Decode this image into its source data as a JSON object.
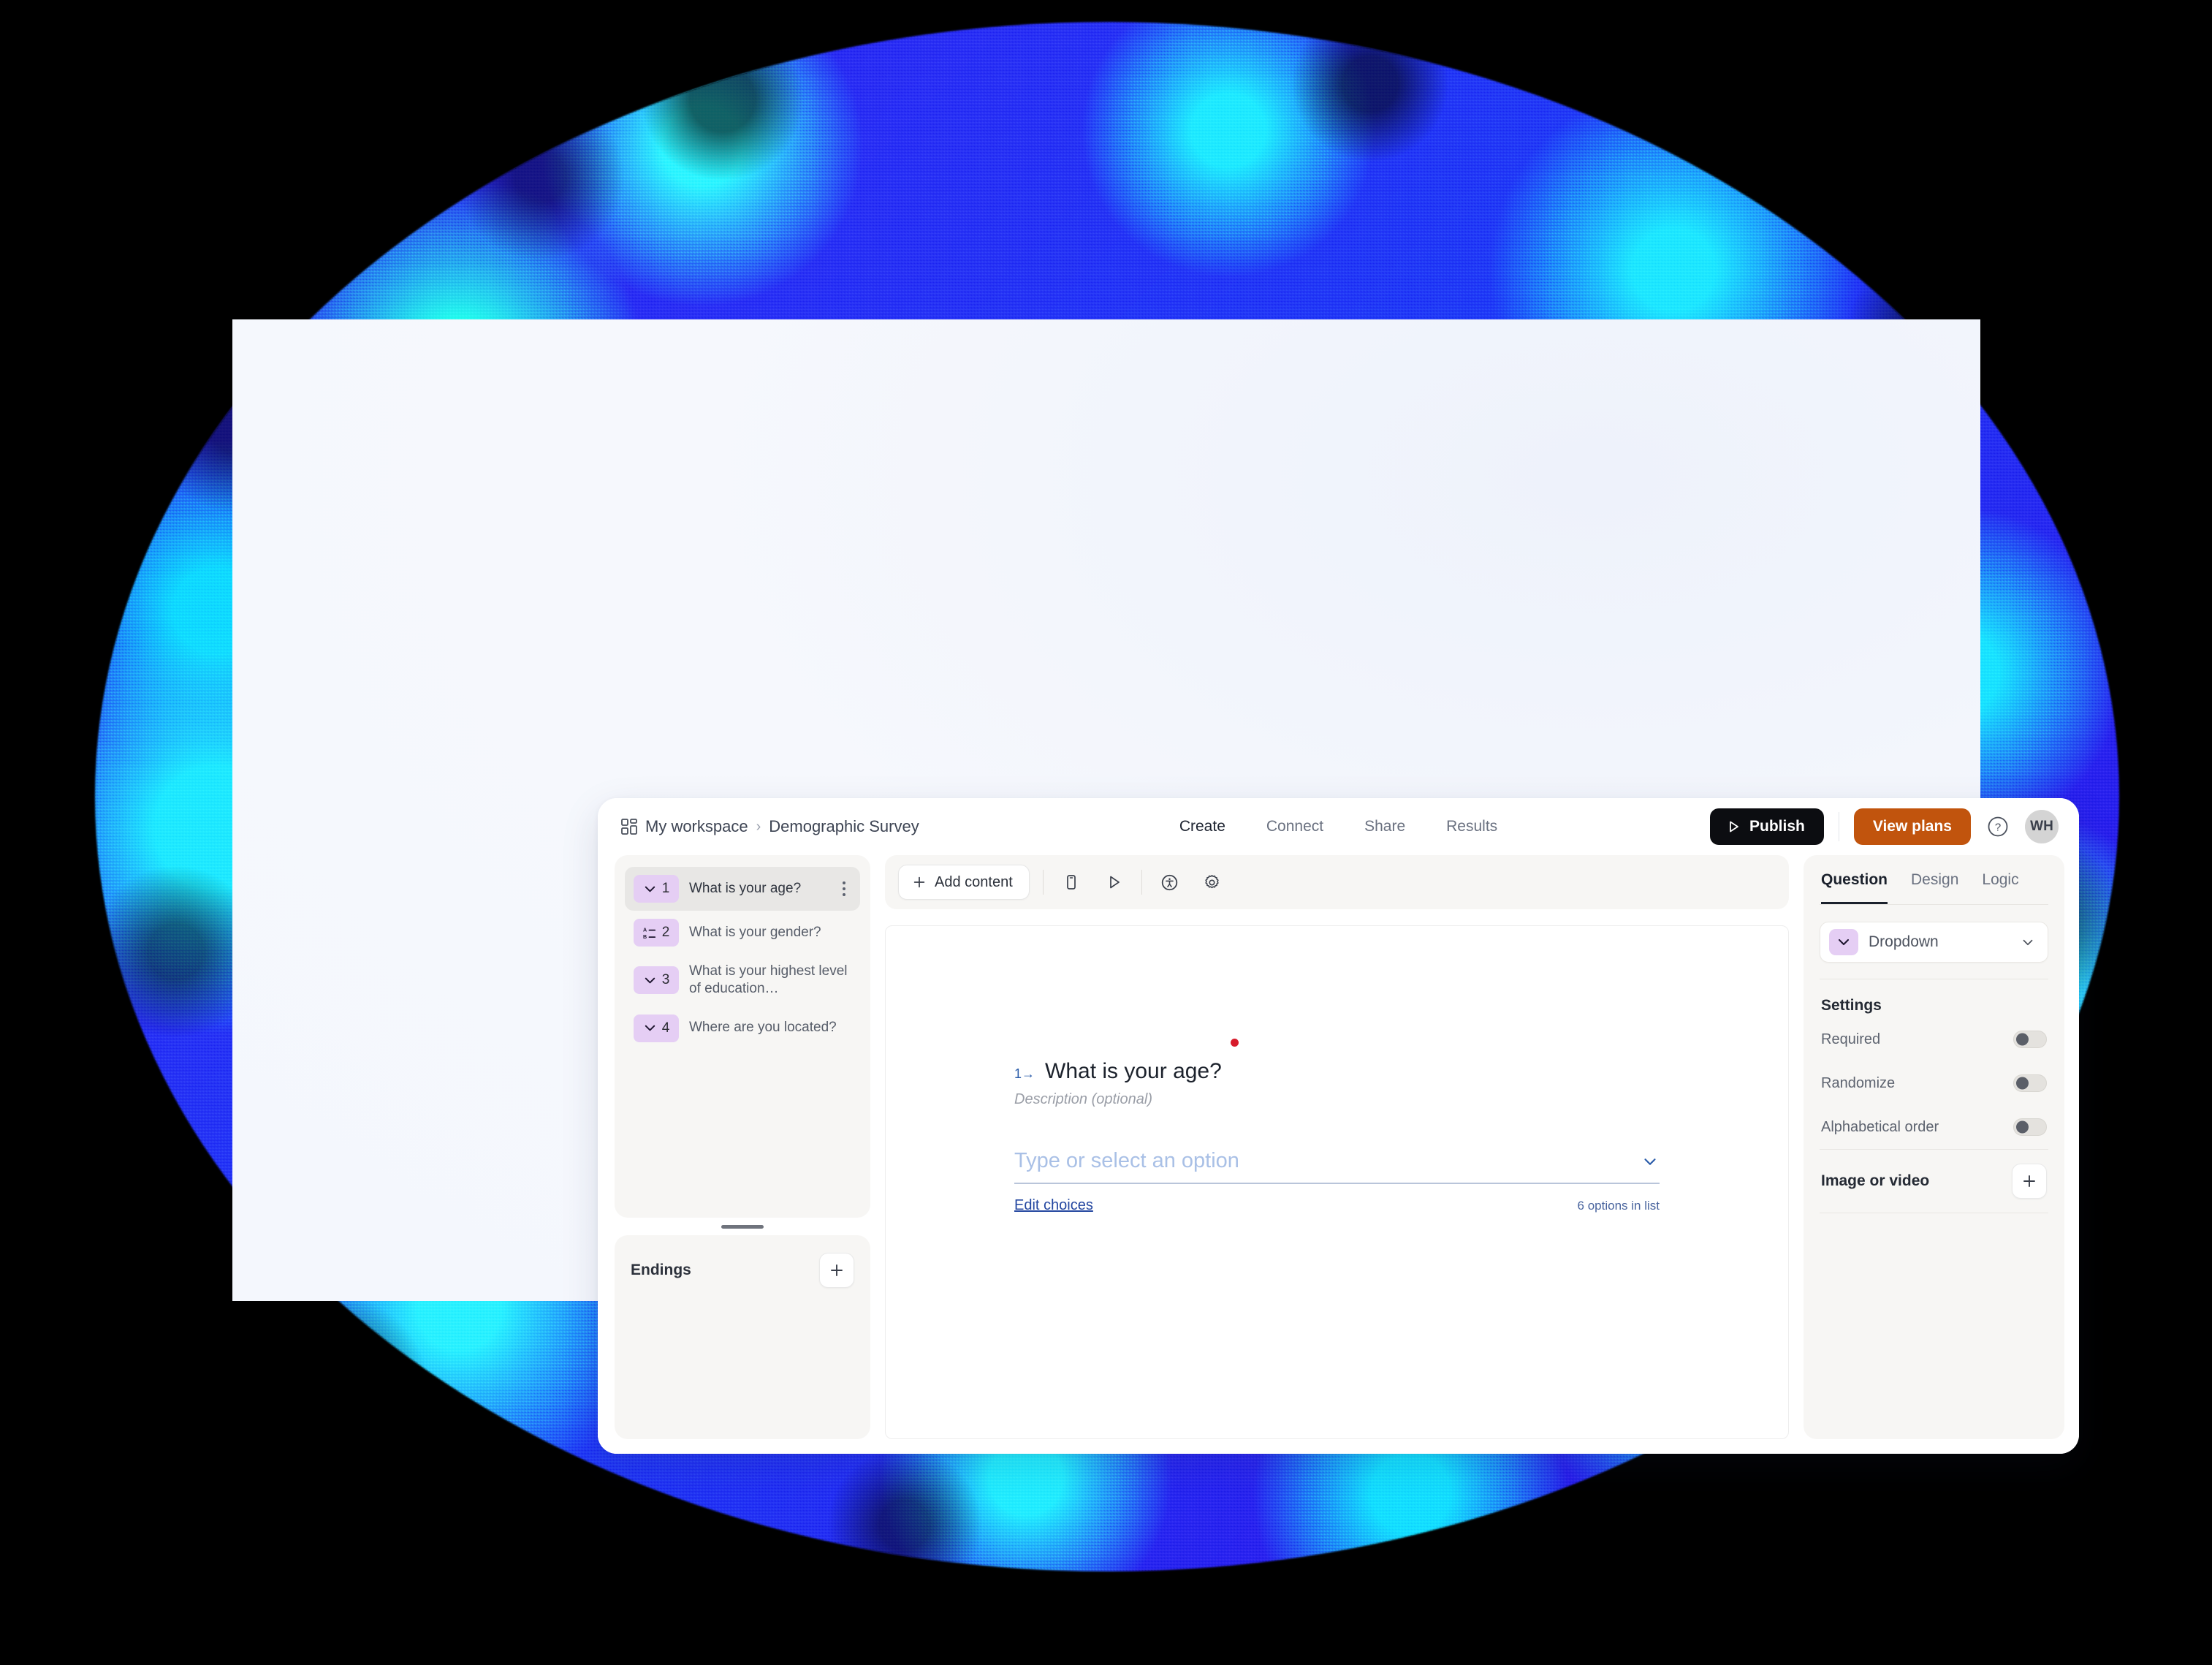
{
  "header": {
    "workspace_icon": "grid-icon",
    "workspace": "My workspace",
    "separator": "›",
    "form_title": "Demographic Survey",
    "nav": [
      {
        "label": "Create",
        "active": true
      },
      {
        "label": "Connect",
        "active": false
      },
      {
        "label": "Share",
        "active": false
      },
      {
        "label": "Results",
        "active": false
      }
    ],
    "publish_label": "Publish",
    "publish_icon": "play-triangle-icon",
    "publish_bg": "#0c0d11",
    "view_plans_label": "View plans",
    "view_plans_bg": "#c1540d",
    "help_icon": "question-circle-icon",
    "avatar_initials": "WH",
    "avatar_bg": "#d4d4d4"
  },
  "sidebar": {
    "questions": [
      {
        "number": "1",
        "icon": "dropdown-chevron-icon",
        "label": "What is your age?",
        "selected": true
      },
      {
        "number": "2",
        "icon": "multiple-choice-icon",
        "label": "What is your gender?",
        "selected": false
      },
      {
        "number": "3",
        "icon": "dropdown-chevron-icon",
        "label": "What is your highest level of education…",
        "selected": false
      },
      {
        "number": "4",
        "icon": "dropdown-chevron-icon",
        "label": "Where are you located?",
        "selected": false
      }
    ],
    "kebab_icon": "more-options-icon",
    "drag_handle_icon": "resize-handle-icon",
    "endings": {
      "title": "Endings",
      "add_icon": "plus-icon"
    },
    "badge_bg": "#e5cef4"
  },
  "toolbar": {
    "add_content_label": "Add content",
    "add_content_icon": "plus-icon",
    "icons": [
      {
        "name": "mobile-preview-icon"
      },
      {
        "name": "preview-play-icon"
      },
      {
        "name": "accessibility-icon"
      },
      {
        "name": "settings-gear-icon"
      }
    ]
  },
  "canvas": {
    "question_index": "1",
    "arrow": "→",
    "question_title": "What is your age?",
    "description_placeholder": "Description (optional)",
    "select_placeholder": "Type or select an option",
    "select_chevron_icon": "chevron-down-icon",
    "edit_choices_label": "Edit choices",
    "options_count_label": "6 options in list",
    "marker_dot_color": "#d71b2b",
    "index_color": "#2a5caa",
    "link_color": "#2346a0"
  },
  "right_panel": {
    "tabs": [
      {
        "label": "Question",
        "active": true
      },
      {
        "label": "Design",
        "active": false
      },
      {
        "label": "Logic",
        "active": false
      }
    ],
    "type_select": {
      "icon": "dropdown-chevron-icon",
      "label": "Dropdown",
      "chevron_icon": "chevron-down-icon"
    },
    "settings_title": "Settings",
    "settings": [
      {
        "label": "Required",
        "value": "off"
      },
      {
        "label": "Randomize",
        "value": "off"
      },
      {
        "label": "Alphabetical order",
        "value": "off"
      }
    ],
    "media": {
      "label": "Image or video",
      "add_icon": "plus-icon"
    }
  }
}
